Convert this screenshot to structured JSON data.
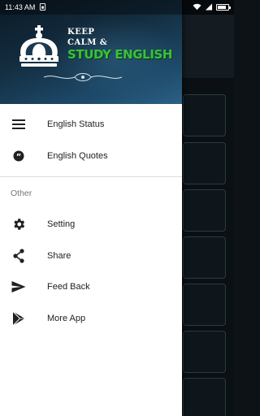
{
  "status_bar": {
    "time": "11:43 AM",
    "icons": [
      "sim-icon",
      "wifi-icon",
      "signal-icon",
      "battery-icon"
    ]
  },
  "header": {
    "logo_line1": "KEEP",
    "logo_line2": "CALM &",
    "logo_line3": "STUDY ENGLISH",
    "accent_color": "#37c23c"
  },
  "menu": {
    "primary": [
      {
        "label": "English Status",
        "icon": "menu-lines-icon"
      },
      {
        "label": "English Quotes",
        "icon": "quote-icon"
      }
    ],
    "section_title": "Other",
    "other": [
      {
        "label": "Setting",
        "icon": "gear-icon"
      },
      {
        "label": "Share",
        "icon": "share-icon"
      },
      {
        "label": "Feed Back",
        "icon": "send-icon"
      },
      {
        "label": "More App",
        "icon": "play-store-icon"
      }
    ]
  },
  "colors": {
    "icon": "#212121",
    "drawer_bg": "#ffffff",
    "header_dark": "#0b1a26",
    "header_light": "#2a6085"
  }
}
